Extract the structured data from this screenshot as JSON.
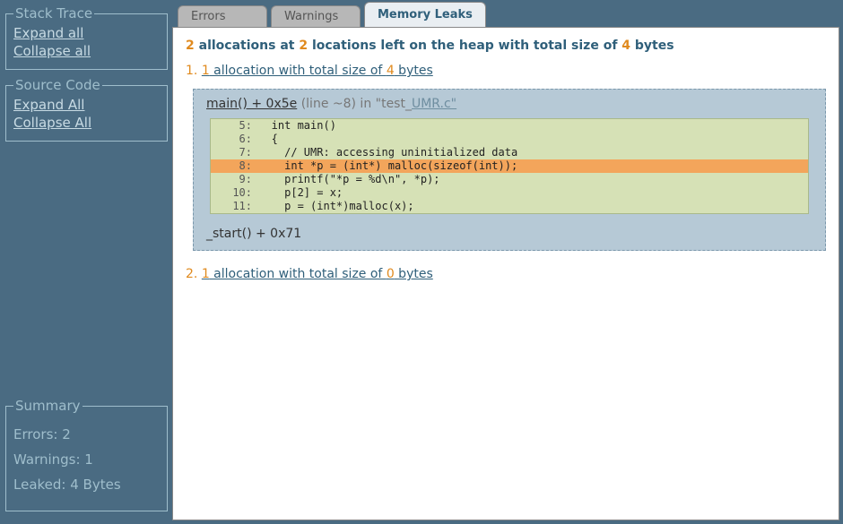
{
  "sidebar": {
    "stackTrace": {
      "legend": "Stack Trace",
      "expand": "Expand all",
      "collapse": "Collapse all"
    },
    "sourceCode": {
      "legend": "Source Code",
      "expand": "Expand All",
      "collapse": "Collapse All"
    },
    "summary": {
      "legend": "Summary",
      "errors": "Errors: 2",
      "warnings": "Warnings: 1",
      "leaked": "Leaked: 4 Bytes"
    }
  },
  "tabs": {
    "errors": "Errors",
    "warnings": "Warnings",
    "leaks": "Memory Leaks"
  },
  "headline": {
    "n_alloc": "2",
    "t1": " allocations at ",
    "n_loc": "2",
    "t2": " locations left on the heap with total size of ",
    "n_bytes": "4",
    "t3": " bytes"
  },
  "item1": {
    "num": "1.",
    "link_n": "1",
    "link_mid": " allocation with total size of ",
    "link_bytes": "4",
    "link_tail": " bytes",
    "frame": {
      "fn": "main() + 0x5e",
      "loc": " (line ~8) in \"test_",
      "file": "UMR.c\""
    },
    "code": [
      {
        "n": "5:",
        "t": "   int main()"
      },
      {
        "n": "6:",
        "t": "   {"
      },
      {
        "n": "7:",
        "t": "     // UMR: accessing uninitialized data"
      },
      {
        "n": "8:",
        "t": "     int *p = (int*) malloc(sizeof(int));",
        "hl": true
      },
      {
        "n": "9:",
        "t": "     printf(\"*p = %d\\n\", *p);"
      },
      {
        "n": "10:",
        "t": "     p[2] = x;"
      },
      {
        "n": "11:",
        "t": "     p = (int*)malloc(x);"
      }
    ],
    "sub": "_start() + 0x71"
  },
  "item2": {
    "num": "2.",
    "link_n": "1",
    "link_mid": " allocation with total size of ",
    "link_bytes": "0",
    "link_tail": " bytes"
  }
}
